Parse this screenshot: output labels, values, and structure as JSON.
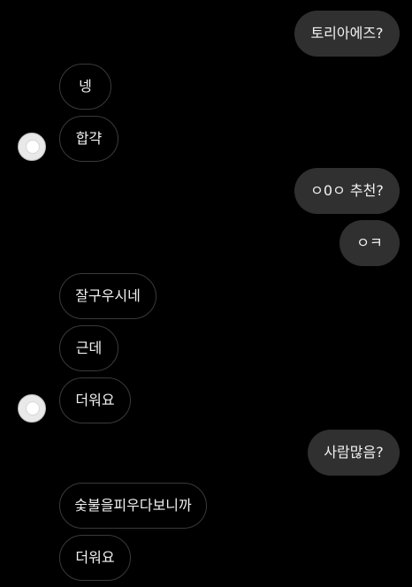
{
  "messages": [
    {
      "side": "outgoing",
      "text": "토리아에즈?"
    },
    {
      "side": "incoming",
      "text": "넹"
    },
    {
      "side": "incoming",
      "text": "합갹"
    },
    {
      "side": "outgoing",
      "text": "ㅇ0ㅇ 추천?"
    },
    {
      "side": "outgoing",
      "text": "ㅇㅋ"
    },
    {
      "side": "incoming",
      "text": "잘구우시네"
    },
    {
      "side": "incoming",
      "text": "근데"
    },
    {
      "side": "incoming",
      "text": "더워요"
    },
    {
      "side": "outgoing",
      "text": "사람많음?"
    },
    {
      "side": "incoming",
      "text": "숯불을피우다보니까"
    },
    {
      "side": "incoming",
      "text": "더워요"
    }
  ],
  "avatar_icon": "default-profile-avatar-icon",
  "colors": {
    "background": "#000000",
    "outgoing_bubble": "#303030",
    "incoming_border": "#3a3a3a",
    "text": "#f2f2f2"
  }
}
